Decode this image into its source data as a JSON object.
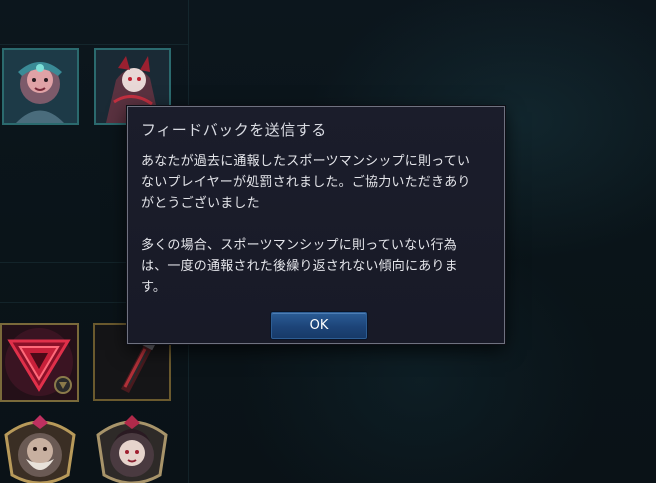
{
  "dialog": {
    "title": "フィードバックを送信する",
    "body": "あなたが過去に通報したスポーツマンシップに則ってい\nないプレイヤーが処罰されました。ご協力いただきあり\nがとうございました\n\n多くの場合、スポーツマンシップに則っていない行為\nは、一度の通報された後繰り返されない傾向にありま\nす。",
    "ok_label": "OK"
  },
  "colors": {
    "dialog_bg": "#1b1d2b",
    "dialog_border": "#6f7280",
    "ok_button": "#1d4478",
    "tile_border_teal": "#2b6a6e",
    "tile_border_gold": "#6b5a2e",
    "emblem_red": "#c8203a"
  },
  "background_icons": [
    "champion-portrait-icon",
    "champion-portrait-icon",
    "ward-emblem-icon",
    "item-icon",
    "champion-crest-icon",
    "champion-crest-icon"
  ]
}
